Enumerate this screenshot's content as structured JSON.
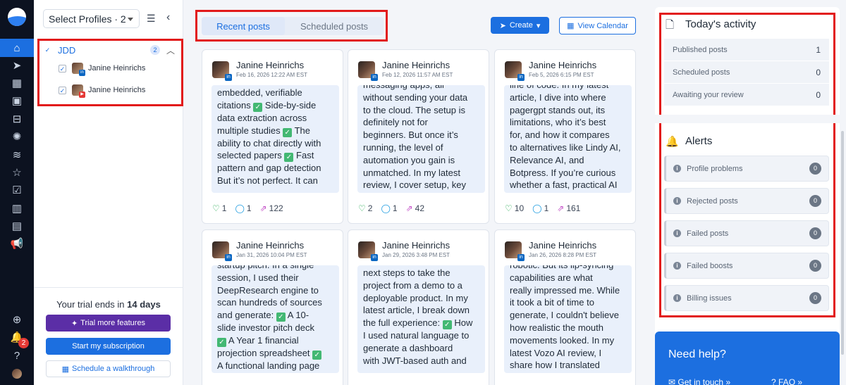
{
  "profiles_panel": {
    "select_label": "Select Profiles · 2",
    "group": {
      "name": "JDD",
      "count": "2"
    },
    "profiles": [
      {
        "name": "Janine Heinrichs",
        "network": "linkedin"
      },
      {
        "name": "Janine Heinrichs",
        "network": "youtube"
      }
    ],
    "trial": {
      "prefix": "Your trial ends in ",
      "days": "14 days"
    },
    "buttons": {
      "trial_features": "Trial more features",
      "subscription": "Start my subscription",
      "walkthrough": "Schedule a walkthrough"
    }
  },
  "rail": {
    "notification_count": "2"
  },
  "tabs": {
    "recent": "Recent posts",
    "scheduled": "Scheduled posts"
  },
  "toolbar": {
    "create": "Create",
    "view_calendar": "View Calendar"
  },
  "posts": [
    {
      "author": "Janine Heinrichs",
      "date": "Feb 16, 2026 12:22 AM EST",
      "likes": "1",
      "comments": "1",
      "reposts": "122",
      "lines": [
        "embedded, verifiable",
        "citations ✅ Side-by-side",
        "data extraction across",
        "multiple studies ✅ The",
        "ability to chat directly with",
        "selected papers ✅ Fast",
        "pattern and gap detection",
        "But it’s not perfect. It can"
      ]
    },
    {
      "author": "Janine Heinrichs",
      "date": "Feb 12, 2026 11:57 AM EST",
      "likes": "2",
      "comments": "1",
      "reposts": "42",
      "lines": [
        "messaging apps, all",
        "without sending your data",
        "to the cloud. The setup is",
        "definitely not for",
        "beginners. But once it’s",
        "running, the level of",
        "automation you gain is",
        "unmatched. In my latest",
        "review, I cover setup, key"
      ]
    },
    {
      "author": "Janine Heinrichs",
      "date": "Feb 5, 2026 6:15 PM EST",
      "likes": "10",
      "comments": "1",
      "reposts": "161",
      "lines": [
        "line of code. In my latest",
        "article, I dive into where",
        "pagergpt stands out, its",
        "limitations, who it’s best",
        "for, and how it compares",
        "to alternatives like Lindy AI,",
        "Relevance AI, and",
        "Botpress. If you’re curious",
        "whether a fast, practical AI"
      ]
    },
    {
      "author": "Janine Heinrichs",
      "date": "Jan 31, 2026 10:04 PM EST",
      "likes": "",
      "comments": "",
      "reposts": "",
      "lines": [
        "startup pitch. In a single",
        "session, I used their",
        "DeepResearch engine to",
        "scan hundreds of sources",
        "and generate: ✅ A 10-",
        "slide investor pitch deck",
        "✅ A Year 1 financial",
        "projection spreadsheet ✅",
        "A functional landing page"
      ]
    },
    {
      "author": "Janine Heinrichs",
      "date": "Jan 29, 2026 3:48 PM EST",
      "likes": "",
      "comments": "",
      "reposts": "",
      "lines": [
        "next steps to take the",
        "project from a demo to a",
        "deployable product. In my",
        "latest article, I break down",
        "the full experience: ✅ How",
        "I used natural language to",
        "generate a dashboard",
        "with JWT-based auth and"
      ]
    },
    {
      "author": "Janine Heinrichs",
      "date": "Jan 26, 2026 8:28 PM EST",
      "likes": "",
      "comments": "",
      "reposts": "",
      "lines": [
        "robotic. But its lip-syncing",
        "capabilities are what",
        "really impressed me. While",
        "it took a bit of time to",
        "generate, I couldn't believe",
        "how realistic the mouth",
        "movements looked. In my",
        "latest Vozo AI review, I",
        "share how I translated"
      ]
    }
  ],
  "activity": {
    "title": "Today's activity",
    "rows": [
      {
        "label": "Published posts",
        "value": "1"
      },
      {
        "label": "Scheduled posts",
        "value": "0"
      },
      {
        "label": "Awaiting your review",
        "value": "0"
      }
    ]
  },
  "alerts": {
    "title": "Alerts",
    "rows": [
      {
        "label": "Profile problems",
        "value": "0"
      },
      {
        "label": "Rejected posts",
        "value": "0"
      },
      {
        "label": "Failed posts",
        "value": "0"
      },
      {
        "label": "Failed boosts",
        "value": "0"
      },
      {
        "label": "Billing issues",
        "value": "0"
      }
    ]
  },
  "help": {
    "title": "Need help?",
    "get_in_touch": "Get in touch",
    "faq": "FAQ"
  }
}
